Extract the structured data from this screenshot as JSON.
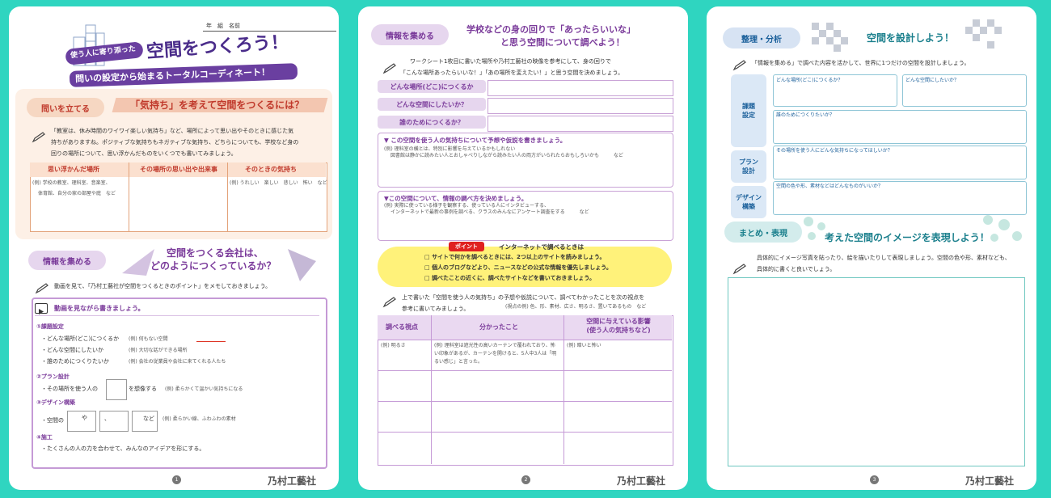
{
  "page1": {
    "name_line": "年　組　名前",
    "title_line1a": "使う人に寄り添った",
    "title_line1b": "空間をつくろう！",
    "title_line2": "問いの設定から始まるトータルコーディネート！",
    "q_label": "問いを立てる",
    "q_heading": "「気持ち」を考えて空間をつくるには？",
    "q_instruction_1": "「教室は、休み時間のワイワイ楽しい気持ち」など、場所によって思い出やそのときに感じた気",
    "q_instruction_2": "持ちがありますね。ポジティブな気持ちもネガティブな気持ち、どちらについても、学校など身の",
    "q_instruction_3": "回りの場所について、思い浮かんだものをいくつでも書いてみましょう。",
    "table_headers": [
      "思い浮かんだ場所",
      "その場所の思い出や出来事",
      "そのときの気持ち"
    ],
    "table_example_1a": "(例) 学校の教室、理科室、音楽室、",
    "table_example_1b": "体育館、自分の家の部屋や庭　など",
    "table_example_3": "(例) うれしい　楽しい　悲しい　怖い　など",
    "info_label": "情報を集める",
    "info_heading_1": "空間をつくる会社は、",
    "info_heading_2": "どのようにつくっているか？",
    "info_instruction": "動画を見て、「乃村工藝社が空間をつくるときのポイント」をメモしておきましょう。",
    "video_label": "動画を見ながら書きましょう。",
    "s1_title": "①課題設定",
    "s1_item1": "・どんな場所(どこ)につくるか",
    "s1_ex1": "(例) 何もない空間",
    "s1_item2": "・どんな空間にしたいか",
    "s1_ex2": "(例) 大切な話ができる場所",
    "s1_item3": "・誰のためにつくりたいか",
    "s1_ex3": "(例) 会社の従業員や会社に来てくれる人たち",
    "s2_title": "②プラン設計",
    "s2_item_a": "・その場所を使う人の",
    "s2_item_b": "を想像する",
    "s2_ex": "(例) 柔らかくて温かい気持ちになる",
    "s3_title": "③デザイン構築",
    "s3_item_a": "・空間の",
    "s3_item_b": "や",
    "s3_item_c": "、",
    "s3_item_d": "など",
    "s3_ex": "(例) 柔らかい線、ふわふわの素材",
    "s4_title": "④施工",
    "s4_item": "・たくさんの人の力を合わせて、みんなのアイデアを形にする。",
    "page_num": "1",
    "logo": "乃村工藝社"
  },
  "page2": {
    "label": "情報を集める",
    "heading_1": "学校などの身の回りで「あったらいいな」",
    "heading_2": "と思う空間について調べよう！",
    "instruction_1": "ワークシート1枚目に書いた場所や乃村工藝社の映像を参考にして、身の回りで",
    "instruction_2": "「こんな場所あったらいいな！」「あの場所を変えたい！」と思う空間を決めましょう。",
    "q1": "どんな場所(どこ)につくるか",
    "q2": "どんな空間にしたいか？",
    "q3": "誰のためにつくるか？",
    "hyp_title": "▼ この空間を使う人の気持ちについて予想や仮説を書きましょう。",
    "hyp_ex_1": "(例) 理科室の横とは、特別に影響を与えているかもしれない",
    "hyp_ex_2": "図書館は静かに読みたい人とおしゃべりしながら読みたい人の両方がいられたらおもしろいかも　　　など",
    "method_title": "▼この空間について、情報の調べ方を決めましょう。",
    "method_ex_1": "(例) 実際に使っている様子を観察する、使っている人にインタビューする、",
    "method_ex_2": "インターネットで最新の事例を調べる、クラスのみんなにアンケート調査をする　　　など",
    "point_label": "ポイント",
    "point_title": "インターネットで調べるときは",
    "point_1": "サイトで何かを調べるときには、2つ以上のサイトを読みましょう。",
    "point_2": "個人のブログなどより、ニュースなどの公式な情報を優先しましょう。",
    "point_3": "調べたことの近くに、調べたサイトなどを書いておきましょう。",
    "after_1": "上で書いた「空間を使う人の気持ち」の予想や仮説について、調べてわかったことを次の視点を",
    "after_2": "参考に書いてみましょう。",
    "after_note": "(視点の例) 色、形、素材、広さ、明るさ、置いてあるもの　など",
    "table_headers": [
      "調べる視点",
      "分かったこと",
      "空間に与えている影響\n(使う人の気持ちなど)"
    ],
    "row_ex_1": "(例) 明るさ",
    "row_ex_2a": "(例) 理科室は遮光性の高いカーテンで覆われており、怖",
    "row_ex_2b": "い印象があるが、カーテンを開けると、5人中3人は「明",
    "row_ex_2c": "るい感じ」と言った。",
    "row_ex_3": "(例) 暗いと怖い",
    "page_num": "2",
    "logo": "乃村工藝社"
  },
  "page3": {
    "label": "整理・分析",
    "heading": "空間を設計しよう！",
    "instruction": "「情報を集める」で調べた内容を活かして、世界に1つだけの空間を設計しましょう。",
    "side1": "課題\n設定",
    "side2": "プラン\n設計",
    "side3": "デザイン\n構築",
    "b1": "どんな場所(どこ)につくるか？",
    "b2": "どんな空間にしたいか？",
    "b3": "誰のためにつくりたいか？",
    "b4": "その場所を使う人にどんな気持ちになってほしいか？",
    "b5": "空間の色や形、素材などはどんなものがいいか？",
    "sum_label": "まとめ・表現",
    "sum_heading": "考えた空間のイメージを表現しよう！",
    "sum_instruction_1": "具体的にイメージ写真を貼ったり、絵を描いたりして表現しましょう。空間の色や形、素材なども、",
    "sum_instruction_2": "具体的に書くと良いでしょう。",
    "page_num": "3",
    "logo": "乃村工藝社"
  }
}
